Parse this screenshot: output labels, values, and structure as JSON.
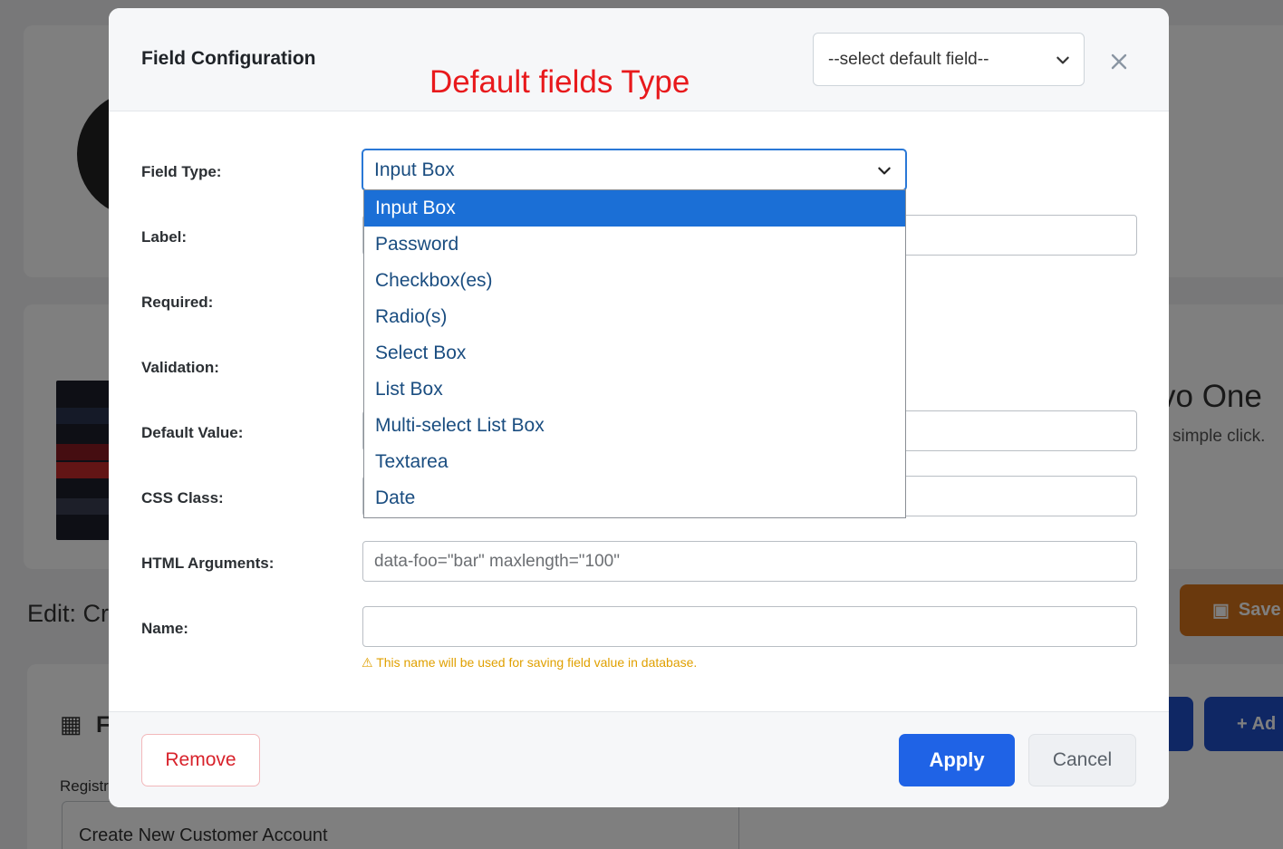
{
  "background": {
    "partial_title_right": "vo One",
    "partial_subtitle_right": "simple click.",
    "edit_heading": "Edit: Cre",
    "save_button_label": "Save",
    "add_button_label": "+ Ad",
    "section_heading_partial": "F",
    "registration_label_partial": "Registr",
    "account_title_value": "Create New Customer Account"
  },
  "modal": {
    "title": "Field Configuration",
    "annotation": "Default fields Type",
    "default_field_select": "--select default field--",
    "labels": {
      "field_type": "Field Type:",
      "label": "Label:",
      "required": "Required:",
      "validation": "Validation:",
      "default_value": "Default Value:",
      "css_class": "CSS Class:",
      "html_arguments": "HTML Arguments:",
      "name": "Name:"
    },
    "field_type_selected": "Input Box",
    "field_type_options": [
      "Input Box",
      "Password",
      "Checkbox(es)",
      "Radio(s)",
      "Select Box",
      "List Box",
      "Multi-select List Box",
      "Textarea",
      "Date"
    ],
    "html_arguments_placeholder": "data-foo=\"bar\" maxlength=\"100\"",
    "name_value": "",
    "name_warning": "⚠ This name will be used for saving field value in database.",
    "buttons": {
      "remove": "Remove",
      "apply": "Apply",
      "cancel": "Cancel"
    }
  },
  "colors": {
    "accent": "#1f63e6",
    "annotation": "#e8191c",
    "warning": "#e0a000",
    "danger": "#d8222b",
    "save_orange": "#d5731b"
  }
}
